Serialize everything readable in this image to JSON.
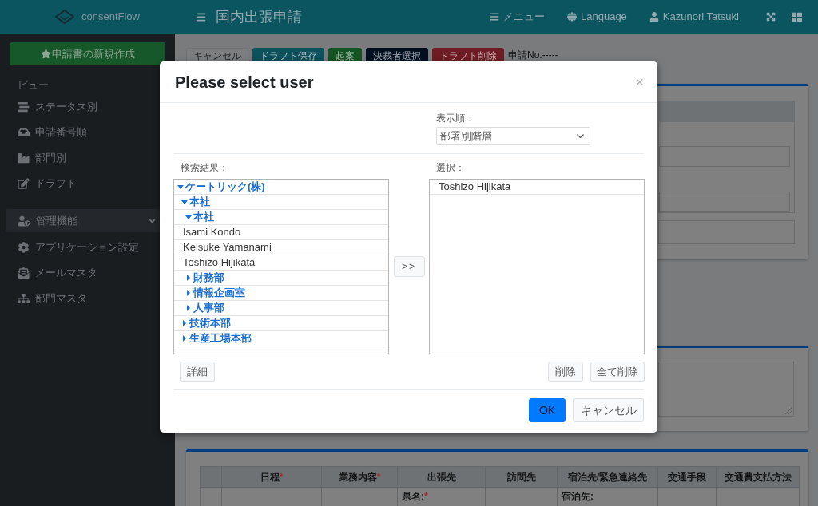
{
  "header": {
    "logo_text": "consentFlow",
    "page_title": "国内出張申請",
    "nav_items": [
      {
        "label": "メニュー"
      },
      {
        "label": "Language"
      },
      {
        "label": "Kazunori Tatsuki"
      }
    ]
  },
  "sidebar": {
    "new_button": "申請書の新規作成",
    "view_heading": "ビュー",
    "view_items": [
      "ステータス別",
      "申請番号順",
      "部門別",
      "ドラフト"
    ],
    "admin_menu": {
      "label": "管理機能",
      "expanded": true,
      "children": [
        "アプリケーション設定",
        "メールマスタ",
        "部門マスタ"
      ]
    }
  },
  "toolbar": {
    "buttons": [
      {
        "label": "キャンセル",
        "kind": "light"
      },
      {
        "label": "ドラフト保存",
        "kind": "info"
      },
      {
        "label": "起案",
        "kind": "success"
      },
      {
        "label": "決裁者選択",
        "kind": "navy"
      },
      {
        "label": "ドラフト削除",
        "kind": "danger"
      }
    ],
    "application_no": "申請No.-----"
  },
  "travel_table": {
    "columns": [
      {
        "label": "日程",
        "required_mark": "*"
      },
      {
        "label": "業務内容",
        "required_mark": "*"
      },
      {
        "label": "出張先"
      },
      {
        "label": "訪問先"
      },
      {
        "label": "宿泊先/緊急連絡先"
      },
      {
        "label": "交通手段"
      },
      {
        "label": "交通費支払方法"
      }
    ],
    "rows": [
      {
        "cells": [
          {
            "kind": "empty"
          },
          {
            "kind": "empty"
          },
          {
            "kind": "field",
            "label": "県名:",
            "required_mark": "*"
          },
          {
            "kind": "empty"
          },
          {
            "kind": "field",
            "label": "宿泊先:"
          },
          {
            "kind": "empty"
          },
          {
            "kind": "empty"
          }
        ]
      }
    ]
  },
  "modal": {
    "title": "Please select user",
    "close_label": "×",
    "sort_order": {
      "label": "表示順：",
      "value": "部署別階層"
    },
    "search_results": {
      "label": "検索結果：",
      "tree": [
        {
          "label": "ケートリック(株)",
          "kind": "group",
          "expanded": true,
          "children": [
            {
              "label": "本社",
              "kind": "group",
              "expanded": true,
              "children": [
                {
                  "label": "本社",
                  "kind": "group",
                  "expanded": true,
                  "children": [
                    {
                      "label": "Isami Kondo",
                      "kind": "user"
                    },
                    {
                      "label": "Keisuke Yamanami",
                      "kind": "user"
                    },
                    {
                      "label": "Toshizo Hijikata",
                      "kind": "user"
                    }
                  ]
                },
                {
                  "label": "財務部",
                  "kind": "group",
                  "expanded": false
                },
                {
                  "label": "情報企画室",
                  "kind": "group",
                  "expanded": false
                },
                {
                  "label": "人事部",
                  "kind": "group",
                  "expanded": false
                }
              ]
            },
            {
              "label": "技術本部",
              "kind": "group",
              "expanded": false
            },
            {
              "label": "生産工場本部",
              "kind": "group",
              "expanded": false
            }
          ]
        }
      ]
    },
    "add_button": ">>",
    "selection": {
      "label": "選択：",
      "items": [
        "Toshizo Hijikata"
      ]
    },
    "detail_button": "詳細",
    "remove_button": "削除",
    "remove_all_button": "全て削除",
    "footer_buttons": [
      {
        "label": "OK",
        "kind": "primary"
      },
      {
        "label": "キャンセル",
        "kind": "secondary"
      }
    ]
  }
}
